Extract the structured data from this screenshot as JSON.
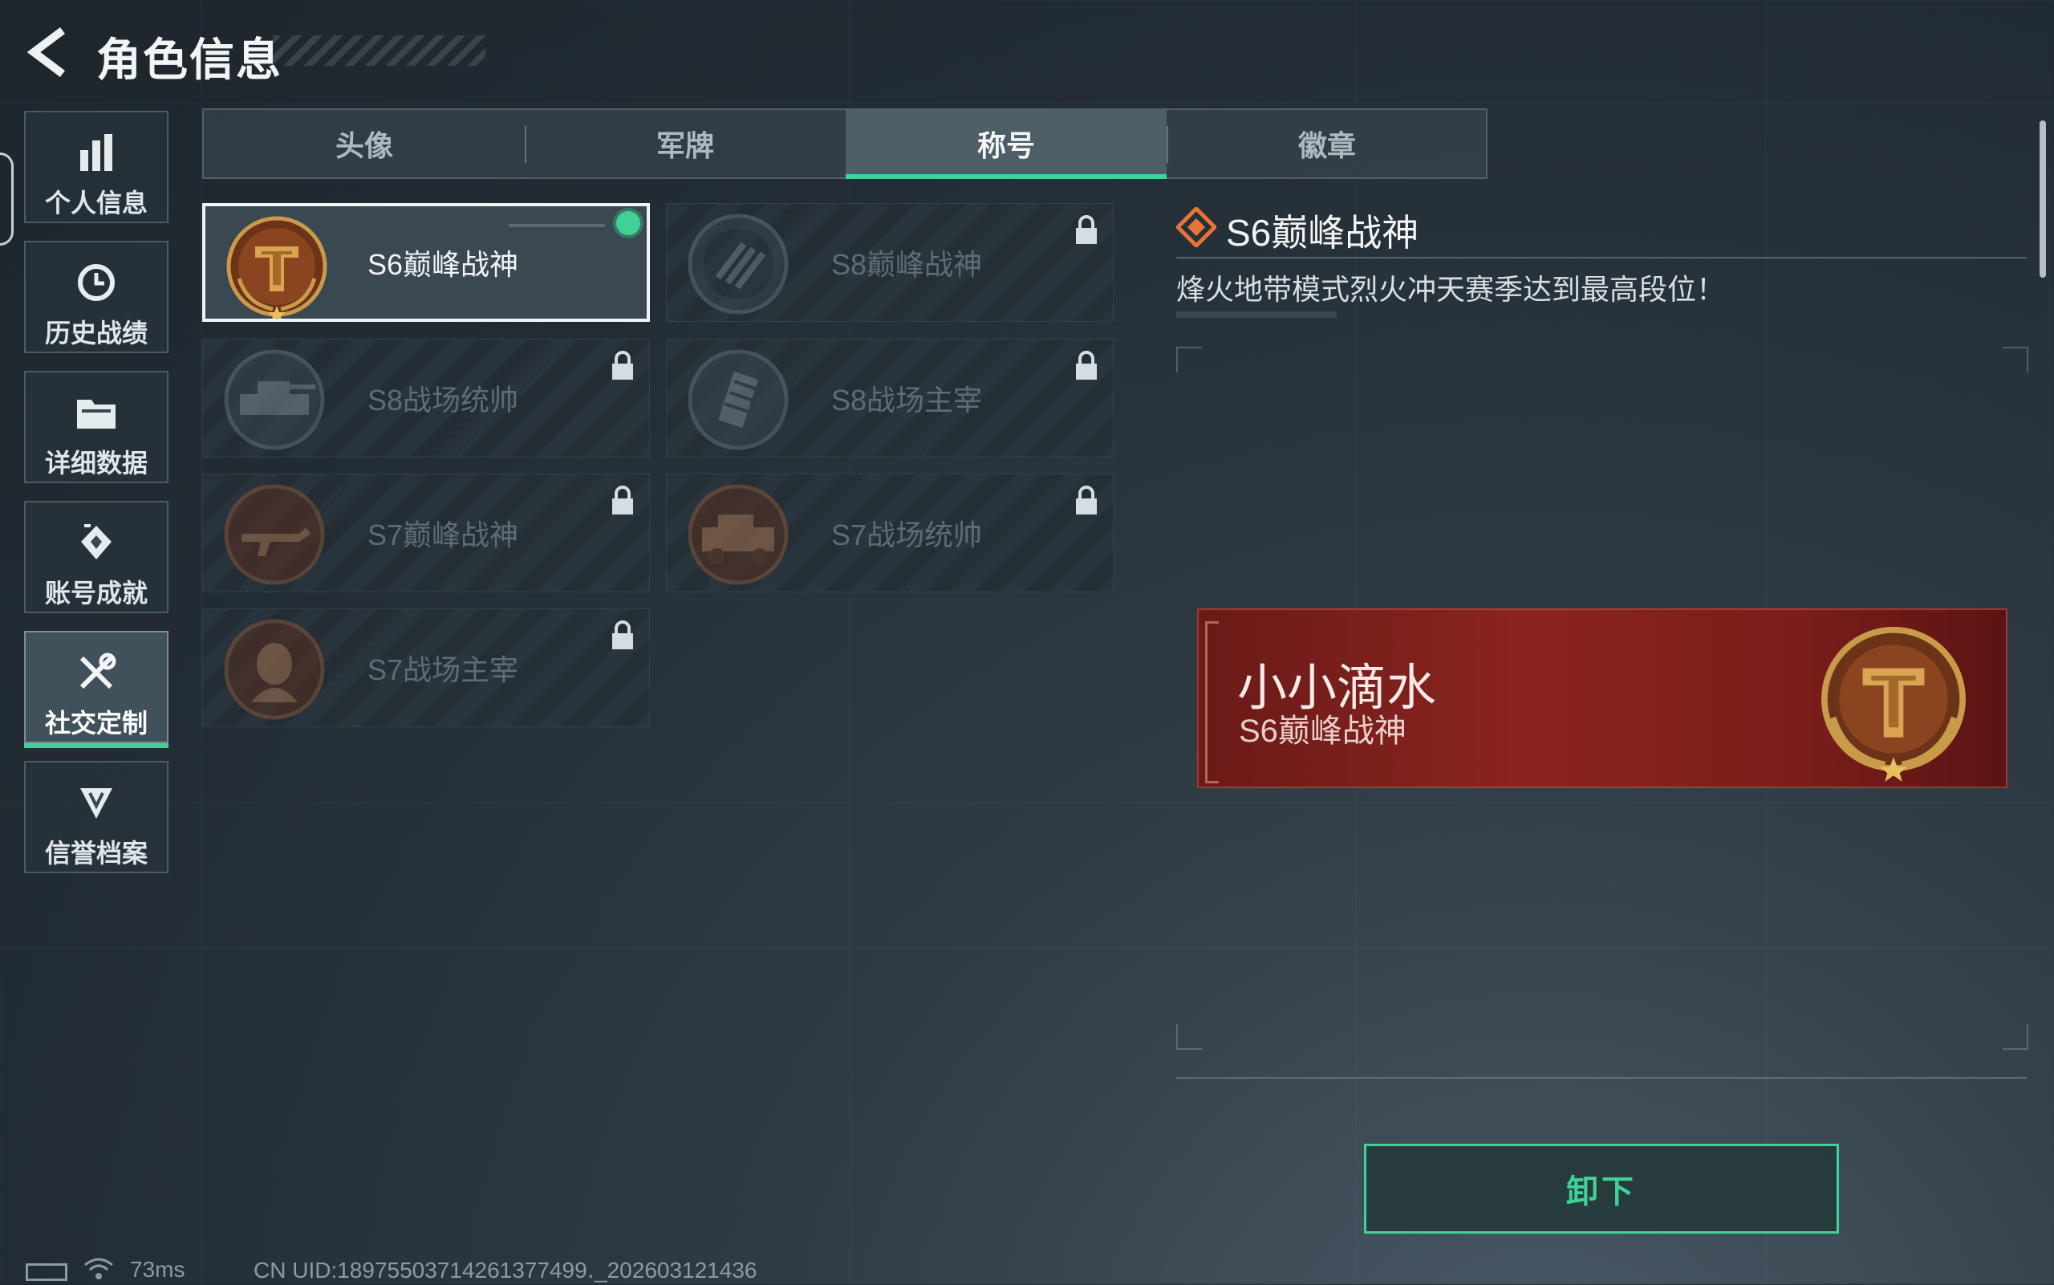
{
  "header": {
    "title": "角色信息"
  },
  "sidebar": {
    "items": [
      {
        "label": "个人信息",
        "icon": "bar-chart-icon"
      },
      {
        "label": "历史战绩",
        "icon": "history-clock-icon"
      },
      {
        "label": "详细数据",
        "icon": "folder-icon"
      },
      {
        "label": "账号成就",
        "icon": "achievement-icon"
      },
      {
        "label": "社交定制",
        "icon": "tools-icon",
        "active": true
      },
      {
        "label": "信誉档案",
        "icon": "credit-shield-icon"
      }
    ]
  },
  "tabs": [
    {
      "label": "头像"
    },
    {
      "label": "军牌"
    },
    {
      "label": "称号",
      "active": true
    },
    {
      "label": "徽章"
    }
  ],
  "titles": [
    {
      "name": "S6巅峰战神",
      "selected": true,
      "locked": false,
      "equipped": true
    },
    {
      "name": "S8巅峰战神",
      "locked": true
    },
    {
      "name": "S8战场统帅",
      "locked": true
    },
    {
      "name": "S8战场主宰",
      "locked": true
    },
    {
      "name": "S7巅峰战神",
      "locked": true
    },
    {
      "name": "S7战场统帅",
      "locked": true
    },
    {
      "name": "S7战场主宰",
      "locked": true
    }
  ],
  "detail": {
    "title": "S6巅峰战神",
    "description": "烽火地带模式烈火冲天赛季达到最高段位！"
  },
  "preview": {
    "player_name": "小小滴水",
    "title": "S6巅峰战神"
  },
  "actions": {
    "unequip_label": "卸下"
  },
  "footer": {
    "ping": "73ms",
    "uid": "CN UID:18975503714261377499․_202603121436"
  },
  "colors": {
    "accent": "#3fd196",
    "preview_red": "#8a2420",
    "gold": "#c99a4a"
  }
}
